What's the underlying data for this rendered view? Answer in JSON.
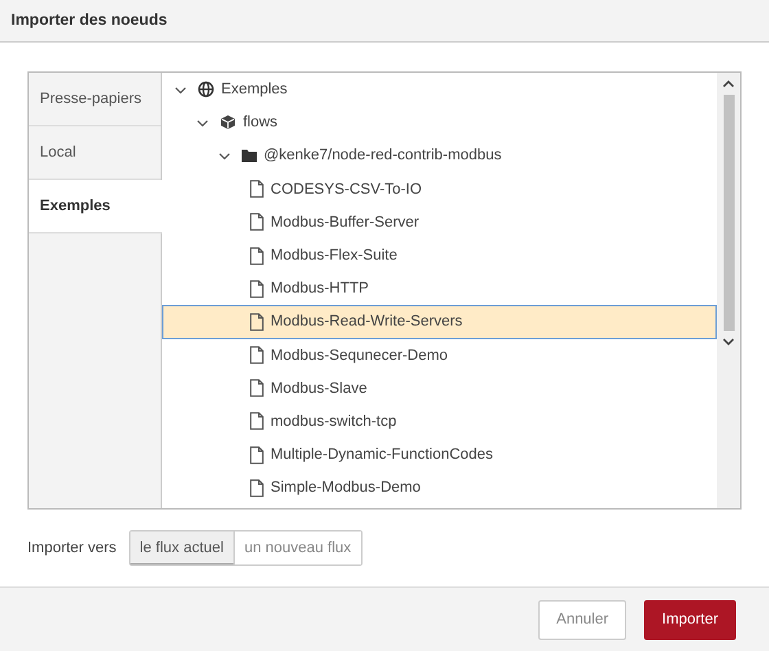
{
  "window": {
    "title": "Importer des noeuds"
  },
  "tabs": [
    {
      "label": "Presse-papiers",
      "selected": false
    },
    {
      "label": "Local",
      "selected": false
    },
    {
      "label": "Exemples",
      "selected": true
    }
  ],
  "tree": [
    {
      "label": "Exemples",
      "kind": "library",
      "expanded": true,
      "selected": false,
      "children": [
        {
          "label": "flows",
          "kind": "package",
          "expanded": true,
          "selected": false,
          "children": [
            {
              "label": "@kenke7/node-red-contrib-modbus",
              "kind": "folder",
              "expanded": true,
              "selected": false,
              "children": [
                {
                  "label": "CODESYS-CSV-To-IO",
                  "kind": "file",
                  "selected": false
                },
                {
                  "label": "Modbus-Buffer-Server",
                  "kind": "file",
                  "selected": false
                },
                {
                  "label": "Modbus-Flex-Suite",
                  "kind": "file",
                  "selected": false
                },
                {
                  "label": "Modbus-HTTP",
                  "kind": "file",
                  "selected": false
                },
                {
                  "label": "Modbus-Read-Write-Servers",
                  "kind": "file",
                  "selected": true
                },
                {
                  "label": "Modbus-Sequnecer-Demo",
                  "kind": "file",
                  "selected": false
                },
                {
                  "label": "Modbus-Slave",
                  "kind": "file",
                  "selected": false
                },
                {
                  "label": "modbus-switch-tcp",
                  "kind": "file",
                  "selected": false
                },
                {
                  "label": "Multiple-Dynamic-FunctionCodes",
                  "kind": "file",
                  "selected": false
                },
                {
                  "label": "Simple-Modbus-Demo",
                  "kind": "file",
                  "selected": false
                }
              ]
            }
          ]
        }
      ]
    }
  ],
  "import_to": {
    "label": "Importer vers",
    "options": [
      {
        "label": "le flux actuel",
        "selected": true
      },
      {
        "label": "un nouveau flux",
        "selected": false
      }
    ]
  },
  "buttons": [
    {
      "label": "Annuler",
      "kind": "secondary"
    },
    {
      "label": "Importer",
      "kind": "primary"
    }
  ]
}
